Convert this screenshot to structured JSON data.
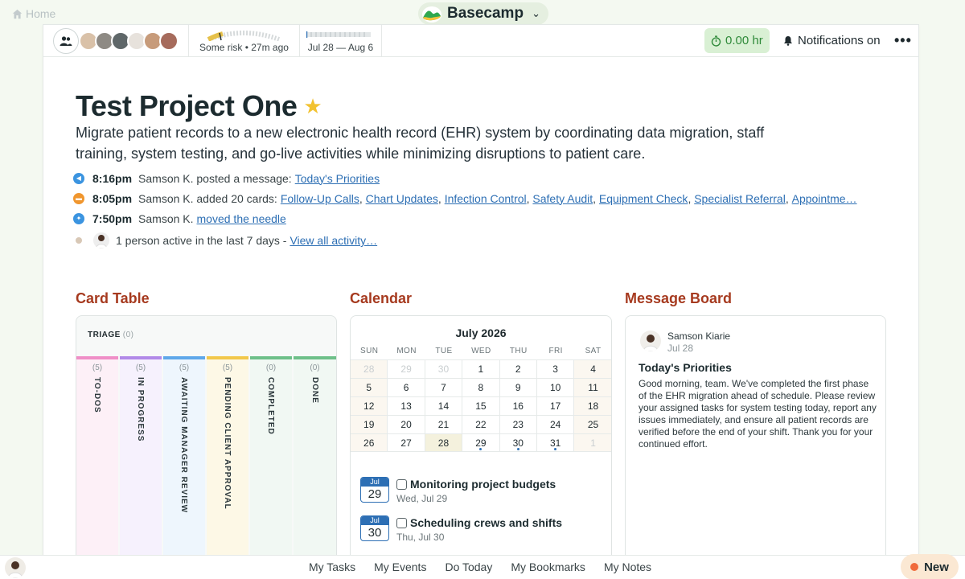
{
  "topbar": {
    "home_label": "Home",
    "app_name": "Basecamp"
  },
  "projectbar": {
    "risk_caption": "Some risk • 27m ago",
    "timeline_caption": "Jul 28 — Aug 6",
    "timer_label": "0.00 hr",
    "notifications_label": "Notifications on",
    "more_label": "•••"
  },
  "project": {
    "title": "Test Project One",
    "description": "Migrate patient records to a new electronic health record (EHR) system by coordinating data migration, staff training, system testing, and go-live activities while minimizing disruptions to patient care."
  },
  "activity": {
    "items": [
      {
        "time": "8:16pm",
        "text": "Samson K. posted a message:",
        "links": [
          "Today's Priorities"
        ],
        "icon_color": "#3b94e0"
      },
      {
        "time": "8:05pm",
        "text": "Samson K. added 20 cards:",
        "links": [
          "Follow-Up Calls",
          "Chart Updates",
          "Infection Control",
          "Safety Audit",
          "Equipment Check",
          "Specialist Referral",
          "Appointme…"
        ],
        "icon_color": "#f0962e"
      },
      {
        "time": "7:50pm",
        "text": "Samson K.",
        "links": [
          "moved the needle"
        ],
        "icon_color": "#3b94e0"
      }
    ],
    "summary_text": "1 person active in the last 7 days -",
    "summary_link": "View all activity…"
  },
  "card_table": {
    "title": "Card Table",
    "triage_label": "TRIAGE",
    "triage_count": "(0)",
    "columns": [
      {
        "label": "TO-DOS",
        "count": "(5)",
        "color": "#ef8fc7",
        "bg": "#fdf0f7"
      },
      {
        "label": "IN PROGRESS",
        "count": "(5)",
        "color": "#b18ae8",
        "bg": "#f6f1fd"
      },
      {
        "label": "AWAITING MANAGER REVIEW",
        "count": "(5)",
        "color": "#5fa8ea",
        "bg": "#eef6fd"
      },
      {
        "label": "PENDING CLIENT APPROVAL",
        "count": "(5)",
        "color": "#f2c84b",
        "bg": "#fdf8e6"
      },
      {
        "label": "COMPLETED",
        "count": "(0)",
        "color": "#6ec089",
        "bg": "#f1f8f3"
      },
      {
        "label": "DONE",
        "count": "(0)",
        "color": "#6ec089",
        "bg": "#f1f8f3"
      }
    ]
  },
  "calendar": {
    "title": "Calendar",
    "month_label": "July 2026",
    "weekdays": [
      "SUN",
      "MON",
      "TUE",
      "WED",
      "THU",
      "FRI",
      "SAT"
    ],
    "weeks": [
      [
        "28",
        "29",
        "30",
        "1",
        "2",
        "3",
        "4"
      ],
      [
        "5",
        "6",
        "7",
        "8",
        "9",
        "10",
        "11"
      ],
      [
        "12",
        "13",
        "14",
        "15",
        "16",
        "17",
        "18"
      ],
      [
        "19",
        "20",
        "21",
        "22",
        "23",
        "24",
        "25"
      ],
      [
        "26",
        "27",
        "28",
        "29",
        "30",
        "31",
        "1"
      ]
    ],
    "events": [
      {
        "month": "Jul",
        "day": "29",
        "title": "Monitoring project budgets",
        "date": "Wed, Jul 29"
      },
      {
        "month": "Jul",
        "day": "30",
        "title": "Scheduling crews and shifts",
        "date": "Thu, Jul 30"
      }
    ]
  },
  "message_board": {
    "title": "Message Board",
    "author": "Samson Kiarie",
    "date": "Jul 28",
    "post_title": "Today's Priorities",
    "post_body": "Good morning, team. We've completed the first phase of the EHR migration ahead of schedule. Please review your assigned tasks for system testing today, report any issues immediately, and ensure all patient records are verified before the end of your shift. Thank you for your continued effort."
  },
  "bottombar": {
    "links": [
      "My Tasks",
      "My Events",
      "Do Today",
      "My Bookmarks",
      "My Notes"
    ],
    "new_label": "New"
  }
}
